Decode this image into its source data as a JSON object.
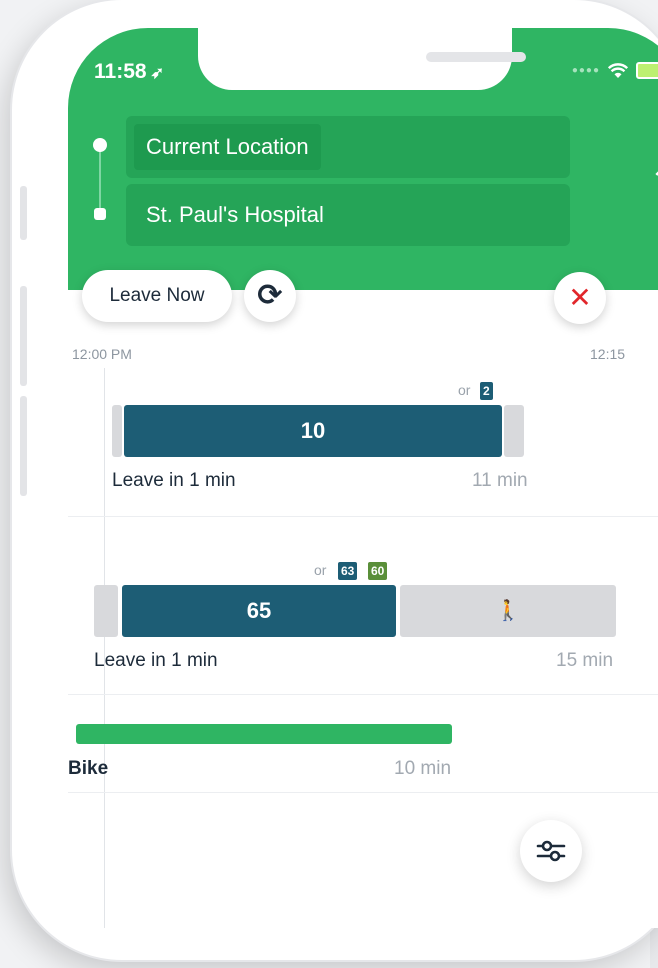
{
  "status_bar": {
    "time": "11:58",
    "location_arrow": "location-arrow-icon"
  },
  "header": {
    "origin_label": "Current Location",
    "destination_label": "St. Paul's Hospital",
    "swap_icon": "swap-arrows-icon"
  },
  "controls": {
    "leave_now_label": "Leave Now",
    "refresh_icon": "refresh-icon",
    "close_icon": "close-icon"
  },
  "timeline": {
    "start_label": "12:00 PM",
    "end_label": "12:15"
  },
  "routes": [
    {
      "or_label": "or",
      "alt_badges": [
        "2"
      ],
      "bus_label": "10",
      "leave_label": "Leave in 1 min",
      "duration": "11 min"
    },
    {
      "or_label": "or",
      "alt_badges": [
        "63",
        "60"
      ],
      "bus_label": "65",
      "walk_icon": "walk-icon",
      "leave_label": "Leave in 1 min",
      "duration": "15 min"
    },
    {
      "mode_label": "Bike",
      "duration": "10 min"
    }
  ],
  "filter_icon": "sliders-icon",
  "colors": {
    "brand_green": "#2fb563",
    "bus_blue": "#1d5d75",
    "badge_green": "#5a8f39",
    "close_red": "#e1262b"
  }
}
